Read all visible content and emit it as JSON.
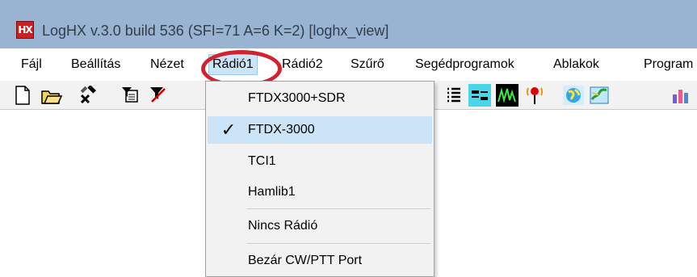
{
  "window": {
    "title": "LogHX v.3.0 build 536 (SFI=71 A=6 K=2) [loghx_view]",
    "app_icon_text": "HX"
  },
  "menubar": {
    "items": [
      {
        "label": "Fájl"
      },
      {
        "label": "Beállítás"
      },
      {
        "label": "Nézet"
      },
      {
        "label": "Rádió1",
        "active": true
      },
      {
        "label": "Rádió2"
      },
      {
        "label": "Szűrő"
      },
      {
        "label": "Segédprogramok"
      },
      {
        "label": "Ablakok"
      },
      {
        "label": "Program"
      }
    ]
  },
  "toolbar": {
    "icons": [
      "new-document-icon",
      "open-folder-icon",
      "tools-icon",
      "filter-icon",
      "filter-off-icon",
      "list-icon",
      "band-map-icon",
      "spectrum-icon",
      "antenna-icon",
      "globe-icon",
      "map-icon",
      "statistics-icon"
    ]
  },
  "dropdown": {
    "items": [
      {
        "label": "FTDX3000+SDR",
        "checked": false
      },
      {
        "label": "FTDX-3000",
        "checked": true
      },
      {
        "label": "TCI1",
        "checked": false
      },
      {
        "label": "Hamlib1",
        "checked": false
      },
      {
        "label": "Nincs Rádió",
        "checked": false
      },
      {
        "label": "Bezár CW/PTT Port",
        "checked": false
      }
    ],
    "check_glyph": "✓"
  },
  "colors": {
    "titlebar": "#99b4d1",
    "highlight_ring": "#d1232f",
    "menu_hover": "#cce4f7",
    "toolbar_accent": "#49d6ea"
  }
}
